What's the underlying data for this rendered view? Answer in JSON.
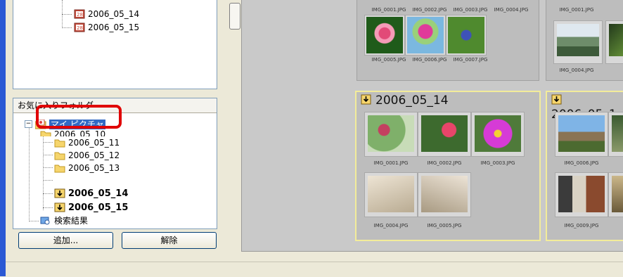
{
  "top_tree": {
    "items": [
      "2006_05_14",
      "2006_05_15"
    ]
  },
  "favorites": {
    "header": "お気に入りフォルダ",
    "root": "マイ ピクチャ",
    "partial": "2006_05_10",
    "folders": [
      "2006_05_11",
      "2006_05_12",
      "2006_05_13"
    ],
    "bold_folders": [
      "2006_05_14",
      "2006_05_15"
    ],
    "search_results": "検索結果"
  },
  "buttons": {
    "add": "追加...",
    "remove": "解除"
  },
  "groups": {
    "g1_caps": [
      "IMG_0001.JPG",
      "IMG_0002.JPG",
      "IMG_0003.JPG",
      "IMG_0004.JPG"
    ],
    "g1_caps2": [
      "IMG_0005.JPG",
      "IMG_0006.JPG",
      "IMG_0007.JPG"
    ],
    "g2_caps": [
      "IMG_0001.JPG",
      "IMG_0004.JPG"
    ],
    "g3_title": "2006_05_14",
    "g3_caps": [
      "IMG_0001.JPG",
      "IMG_0002.JPG",
      "IMG_0003.JPG"
    ],
    "g3_caps2": [
      "IMG_0004.JPG",
      "IMG_0005.JPG"
    ],
    "g4_title": "2006_05_1",
    "g4_caps": [
      "IMG_0006.JPG",
      "IMG_0009.JPG"
    ]
  },
  "colors": {
    "selection": "#316ac5",
    "highlight": "#e00000",
    "group_border": "#f3ec9a"
  },
  "icons": {
    "folder": "folder-icon",
    "photo": "photo-icon",
    "save": "import-icon",
    "search": "search-icon"
  }
}
